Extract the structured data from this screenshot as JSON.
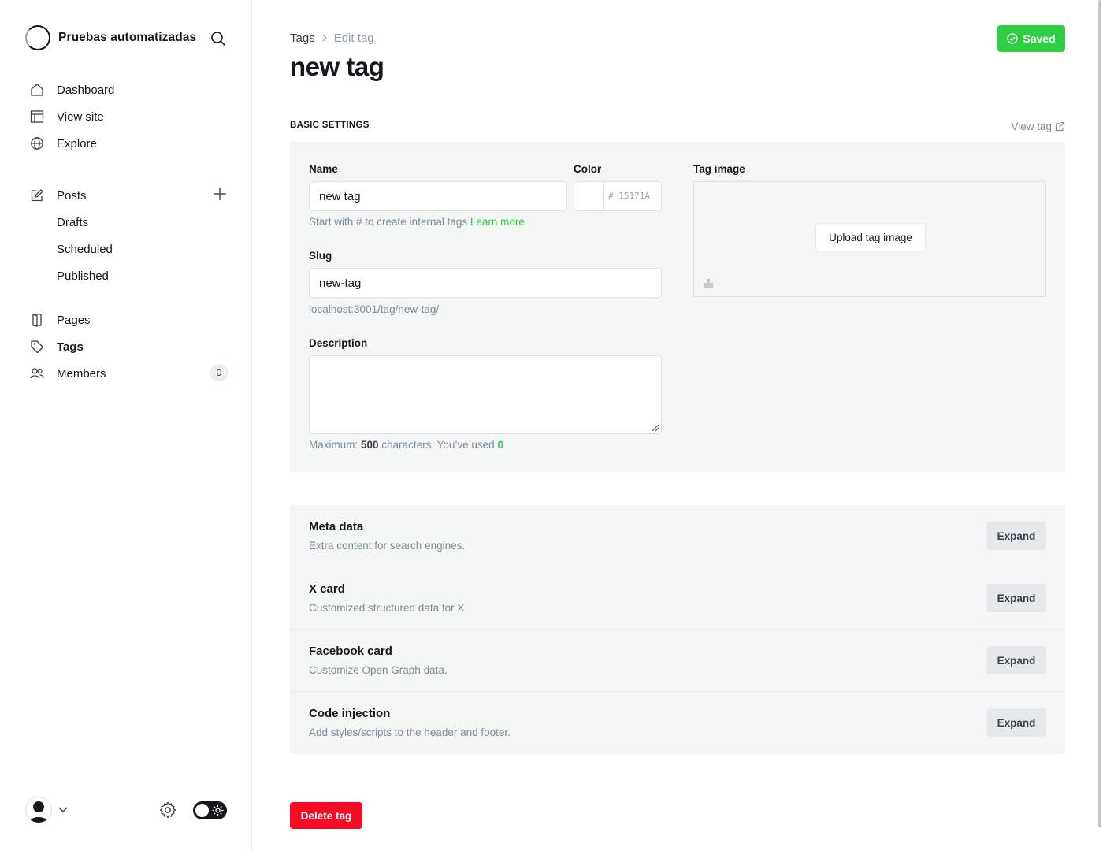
{
  "brand": {
    "title": "Pruebas automatizadas"
  },
  "sidebar": {
    "items": [
      {
        "label": "Dashboard",
        "icon": "home-icon"
      },
      {
        "label": "View site",
        "icon": "layout-icon"
      },
      {
        "label": "Explore",
        "icon": "globe-icon"
      },
      {
        "label": "Posts",
        "icon": "edit-icon"
      },
      {
        "label": "Drafts"
      },
      {
        "label": "Scheduled"
      },
      {
        "label": "Published"
      },
      {
        "label": "Pages",
        "icon": "page-icon"
      },
      {
        "label": "Tags",
        "icon": "tag-icon"
      },
      {
        "label": "Members",
        "icon": "members-icon"
      }
    ],
    "members_count": "0"
  },
  "breadcrumb": {
    "parent": "Tags",
    "current": "Edit tag"
  },
  "page": {
    "title": "new tag",
    "saved_label": "Saved"
  },
  "settings": {
    "section_title": "BASIC SETTINGS",
    "view_tag": "View tag",
    "name_label": "Name",
    "name_value": "new tag",
    "color_label": "Color",
    "color_hex": "15171A",
    "name_hint": "Start with # to create internal tags",
    "name_hint_link": "Learn more",
    "slug_label": "Slug",
    "slug_value": "new-tag",
    "slug_url": "localhost:3001/tag/new-tag/",
    "description_label": "Description",
    "desc_hint_prefix": "Maximum:",
    "desc_hint_max": "500",
    "desc_hint_mid": "characters. You’ve used",
    "desc_hint_used": "0",
    "tag_image_label": "Tag image",
    "upload_label": "Upload tag image"
  },
  "accordion": [
    {
      "title": "Meta data",
      "desc": "Extra content for search engines.",
      "button": "Expand"
    },
    {
      "title": "X card",
      "desc": "Customized structured data for X.",
      "button": "Expand"
    },
    {
      "title": "Facebook card",
      "desc": "Customize Open Graph data.",
      "button": "Expand"
    },
    {
      "title": "Code injection",
      "desc": "Add styles/scripts to the header and footer.",
      "button": "Expand"
    }
  ],
  "delete_label": "Delete tag",
  "colors": {
    "accent": "#30cf43",
    "danger": "#f50b23",
    "text": "#15171a"
  }
}
